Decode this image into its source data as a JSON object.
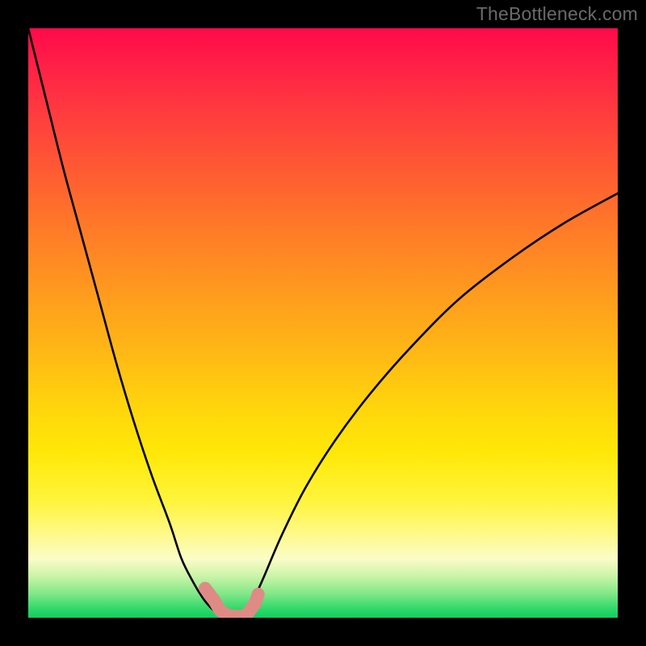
{
  "watermark": "TheBottleneck.com",
  "colors": {
    "background": "#000000",
    "curve": "#000000",
    "marker": "#e08a86",
    "marker_stroke": "#d97d79"
  },
  "chart_data": {
    "type": "line",
    "title": "",
    "xlabel": "",
    "ylabel": "",
    "xlim": [
      0,
      100
    ],
    "ylim": [
      0,
      100
    ],
    "series": [
      {
        "name": "left-curve",
        "x": [
          0,
          3,
          6,
          9,
          12,
          15,
          18,
          21,
          24,
          26,
          28,
          29.5,
          30.5,
          31.5,
          32.5,
          33.5
        ],
        "values": [
          100,
          88,
          76,
          65,
          54,
          43,
          33,
          24,
          16,
          10,
          6,
          3.5,
          2.2,
          1.2,
          0.5,
          0.0
        ]
      },
      {
        "name": "right-curve",
        "x": [
          37,
          38,
          40,
          43,
          47,
          52,
          58,
          65,
          73,
          82,
          91,
          100
        ],
        "values": [
          0.0,
          2.5,
          7,
          14,
          22,
          30,
          38,
          46,
          54,
          61,
          67,
          72
        ]
      }
    ],
    "markers": [
      {
        "x": 30.0,
        "y": 5.0
      },
      {
        "x": 31.5,
        "y": 3.0
      },
      {
        "x": 32.5,
        "y": 1.3
      },
      {
        "x": 33.8,
        "y": 0.4
      },
      {
        "x": 35.5,
        "y": 0.2
      },
      {
        "x": 37.0,
        "y": 0.4
      },
      {
        "x": 38.5,
        "y": 2.5
      },
      {
        "x": 39.0,
        "y": 4.0
      }
    ]
  }
}
